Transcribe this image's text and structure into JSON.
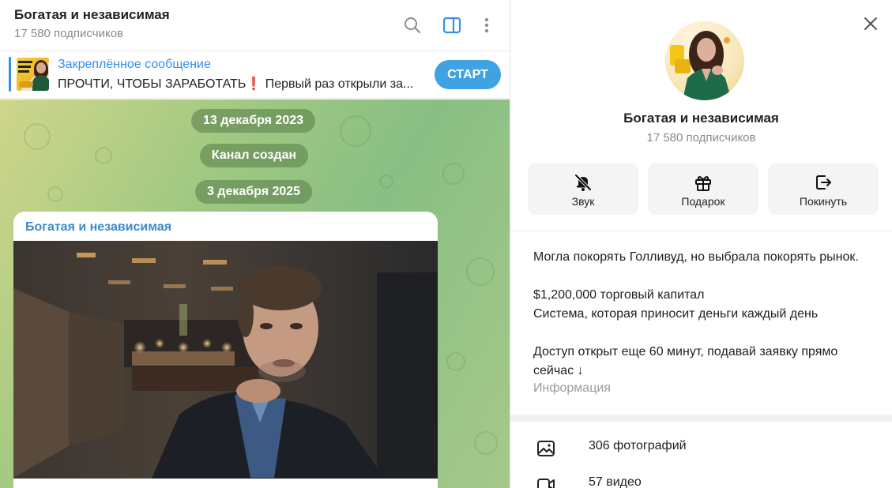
{
  "chat": {
    "title": "Богатая и независимая",
    "subscribers": "17 580 подписчиков",
    "pinned": {
      "label": "Закреплённое сообщение",
      "text_a": "ПРОЧТИ, ЧТОБЫ ЗАРАБОТАТЬ",
      "text_excl": "❗",
      "text_b": " Первый раз открыли за...",
      "button": "СТАРТ"
    },
    "date_1": "13 декабря 2023",
    "service": "Канал создан",
    "date_2": "3 декабря 2025",
    "message_author": "Богатая и независимая"
  },
  "profile": {
    "name": "Богатая и независимая",
    "subscribers": "17 580 подписчиков",
    "actions": {
      "sound": "Звук",
      "gift": "Подарок",
      "leave": "Покинуть"
    },
    "about_text": "Могла покорять Голливуд, но выбрала покорять рынок.\n\n$1,200,000 торговый капитал\nСистема, которая приносит деньги каждый день\n\nДоступ открыт еще 60 минут, подавай заявку прямо сейчас ↓",
    "about_label": "Информация",
    "media": {
      "photos": "306 фотографий",
      "videos": "57 видео"
    }
  },
  "colors": {
    "accent": "#3390ec",
    "start_button": "#3ea2e3",
    "author": "#3a8bc9"
  },
  "icons": [
    "search-icon",
    "sidebar-toggle-icon",
    "more-vertical-icon",
    "close-icon",
    "bell-off-icon",
    "gift-icon",
    "leave-icon",
    "photo-icon",
    "video-icon"
  ]
}
